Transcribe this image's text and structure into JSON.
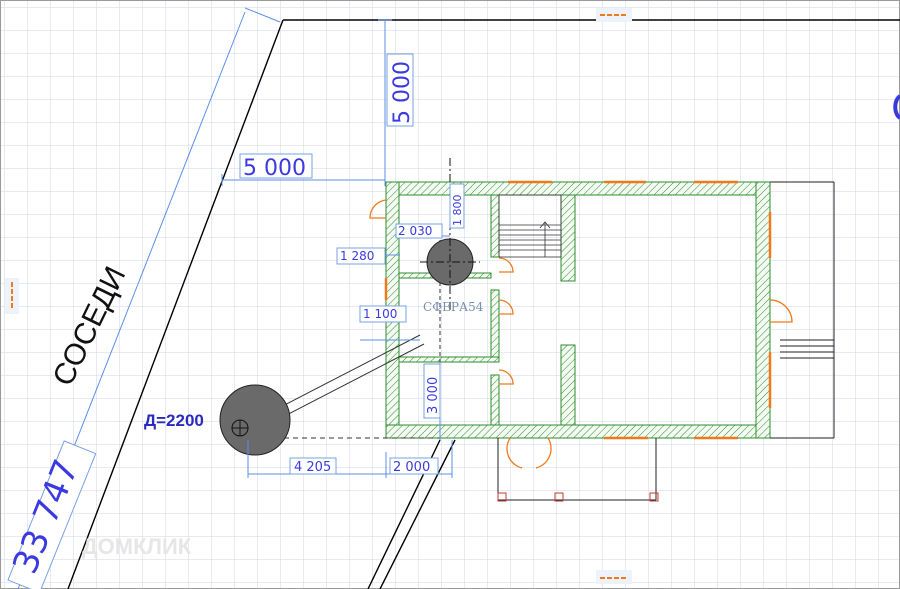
{
  "plan": {
    "neighbors_label": "СОСЕДИ",
    "plot_side_label": "33 747",
    "dims": {
      "setback_vertical": "5 000",
      "setback_horizontal": "5 000",
      "d_1800": "1 800",
      "d_2030": "2 030",
      "d_1280": "1 280",
      "d_1100": "1 100",
      "d_3000": "3 000",
      "d_4205": "4 205",
      "d_2000": "2 000"
    },
    "septic_label": "Д=2200",
    "watermark_main": "СФЕРА54",
    "watermark_bottom": "ДОМКЛИК"
  },
  "colors": {
    "grid": "#cfd6e6",
    "dimension": "#3a3ae0",
    "window": "#f07a1a",
    "wall_hatch": "#2e8b2e",
    "tank": "#555555"
  },
  "icons": [
    "resize-handle-top",
    "resize-handle-left",
    "resize-handle-bottom"
  ]
}
